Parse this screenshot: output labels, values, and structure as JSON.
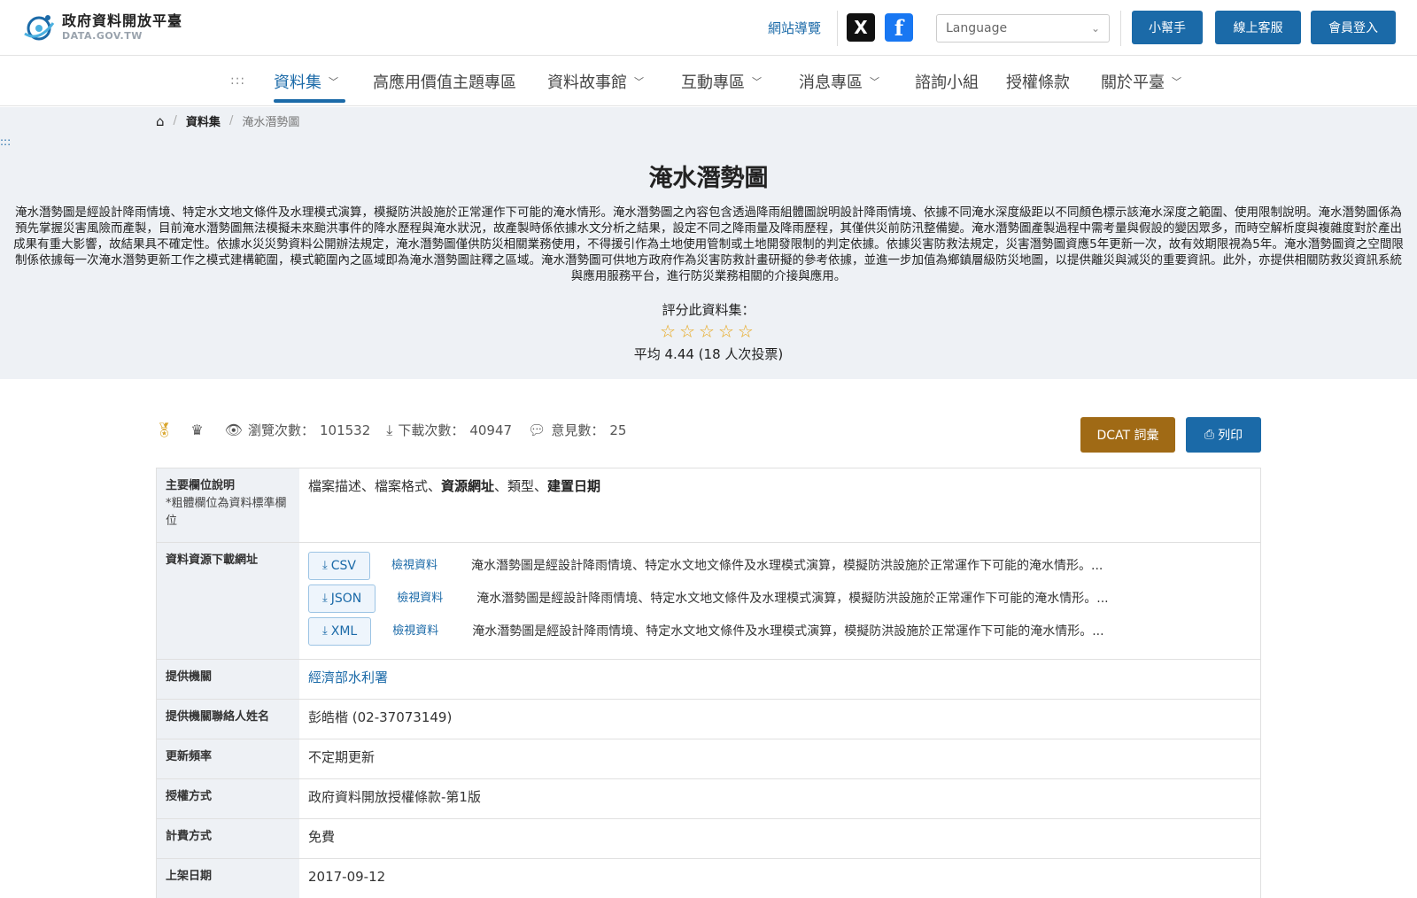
{
  "header": {
    "logo_title": "政府資料開放平臺",
    "logo_sub": "DATA.GOV.TW",
    "sitemap": "網站導覽",
    "social_x": "X",
    "social_fb": "f",
    "language_placeholder": "Language",
    "help": "小幫手",
    "service": "線上客服",
    "login": "會員登入"
  },
  "nav": {
    "dots": ":::",
    "items": [
      {
        "label": "資料集"
      },
      {
        "label": "高應用價值主題專區"
      },
      {
        "label": "資料故事館"
      },
      {
        "label": "互動專區"
      },
      {
        "label": "消息專區"
      },
      {
        "label": "諮詢小組"
      },
      {
        "label": "授權條款"
      },
      {
        "label": "關於平臺"
      }
    ]
  },
  "breadcrumb": {
    "home_icon": "home-icon",
    "crumb": "資料集",
    "current": "淹水潛勢圖"
  },
  "hero": {
    "dots": ":::",
    "title": "淹水潛勢圖",
    "description": "淹水潛勢圖是經設計降雨情境、特定水文地文條件及水理模式演算，模擬防洪設施於正常運作下可能的淹水情形。淹水潛勢圖之內容包含透過降雨組體圖說明設計降雨情境、依據不同淹水深度級距以不同顏色標示該淹水深度之範圍、使用限制說明。淹水潛勢圖係為預先掌握災害風險而產製，目前淹水潛勢圖無法模擬未來颱洪事件的降水歷程與淹水狀況，故產製時係依據水文分析之結果，設定不同之降雨量及降雨歷程，其僅供災前防汛整備變。淹水潛勢圖產製過程中需考量與假設的變因眾多，而時空解析度與複雜度對於產出成果有重大影響，故結果具不確定性。依據水災災勢資料公開辦法規定，淹水潛勢圖僅供防災相關業務使用，不得援引作為土地使用管制或土地開發限制的判定依據。依據災害防救法規定，災害潛勢圖資應5年更新一次，故有效期限視為5年。淹水潛勢圖資之空間限制係依據每一次淹水潛勢更新工作之模式建構範圍，模式範圍內之區域即為淹水潛勢圖註釋之區域。淹水潛勢圖可供地方政府作為災害防救計畫研擬的參考依據，並進一步加值為鄉鎮層級防災地圖，以提供離災與減災的重要資訊。此外，亦提供相關防救災資訊系統與應用服務平台，進行防災業務相關的介接與應用。",
    "rate_label": "評分此資料集：",
    "stars": "☆☆☆☆☆",
    "rating_max": 5,
    "average": "平均 4.44 (18 人次投票)"
  },
  "stats": {
    "views_label": "瀏覽次數：",
    "views": "101532",
    "downloads_label": "下載次數：",
    "downloads": "40947",
    "comments_label": "意見數：",
    "comments": "25",
    "dcat": "DCAT 詞彙",
    "print": "列印"
  },
  "table": {
    "fields_label": "主要欄位說明",
    "fields_note": "*粗體欄位為資料標準欄位",
    "fields_parts": [
      "檔案描述、檔案格式、",
      "資源網址",
      "、類型、",
      "建置日期"
    ],
    "download_label": "資料資源下載網址",
    "resources": [
      {
        "format": "CSV",
        "view": "檢視資料",
        "desc": "淹水潛勢圖是經設計降雨情境、特定水文地文條件及水理模式演算，模擬防洪設施於正常運作下可能的淹水情形。..."
      },
      {
        "format": "JSON",
        "view": "檢視資料",
        "desc": "淹水潛勢圖是經設計降雨情境、特定水文地文條件及水理模式演算，模擬防洪設施於正常運作下可能的淹水情形。..."
      },
      {
        "format": "XML",
        "view": "檢視資料",
        "desc": "淹水潛勢圖是經設計降雨情境、特定水文地文條件及水理模式演算，模擬防洪設施於正常運作下可能的淹水情形。..."
      }
    ],
    "rows": [
      {
        "label": "提供機關",
        "value": "經濟部水利署"
      },
      {
        "label": "提供機關聯絡人姓名",
        "value": "彭皓楷 (02-37073149)"
      },
      {
        "label": "更新頻率",
        "value": "不定期更新"
      },
      {
        "label": "授權方式",
        "value": "政府資料開放授權條款-第1版"
      },
      {
        "label": "計費方式",
        "value": "免費"
      },
      {
        "label": "上架日期",
        "value": "2017-09-12"
      }
    ]
  },
  "colors": {
    "primary": "#1b6aa8",
    "gold": "#a06a15",
    "hero_bg": "#eef1f5",
    "star": "#e7a517"
  }
}
